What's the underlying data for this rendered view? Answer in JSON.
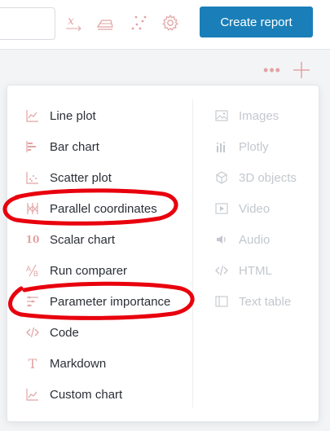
{
  "toolbar": {
    "create_report_label": "Create report",
    "icons": [
      "function-icon",
      "inkwell-icon",
      "dots-chart-icon",
      "gear-icon"
    ]
  },
  "panel_header": {
    "more_icon": "more-dots-icon",
    "plus_icon": "plus-icon"
  },
  "menu": {
    "left": [
      {
        "label": "Line plot",
        "icon": "line-plot-icon"
      },
      {
        "label": "Bar chart",
        "icon": "bar-chart-icon"
      },
      {
        "label": "Scatter plot",
        "icon": "scatter-plot-icon"
      },
      {
        "label": "Parallel coordinates",
        "icon": "parallel-coordinates-icon"
      },
      {
        "label": "Scalar chart",
        "icon": "scalar-chart-icon",
        "glyph": "10"
      },
      {
        "label": "Run comparer",
        "icon": "run-comparer-icon"
      },
      {
        "label": "Parameter importance",
        "icon": "parameter-importance-icon"
      },
      {
        "label": "Code",
        "icon": "code-icon"
      },
      {
        "label": "Markdown",
        "icon": "markdown-icon",
        "glyph": "T"
      },
      {
        "label": "Custom chart",
        "icon": "custom-chart-icon"
      }
    ],
    "right": [
      {
        "label": "Images",
        "icon": "images-icon"
      },
      {
        "label": "Plotly",
        "icon": "plotly-icon"
      },
      {
        "label": "3D objects",
        "icon": "cube-icon"
      },
      {
        "label": "Video",
        "icon": "video-icon"
      },
      {
        "label": "Audio",
        "icon": "audio-icon"
      },
      {
        "label": "HTML",
        "icon": "html-icon"
      },
      {
        "label": "Text table",
        "icon": "text-table-icon"
      }
    ]
  },
  "colors": {
    "accent": "#1a7fb8",
    "icon_muted": "#e2a3a3",
    "disabled_text": "#c3c8ce",
    "annotation": "#e8000d"
  }
}
